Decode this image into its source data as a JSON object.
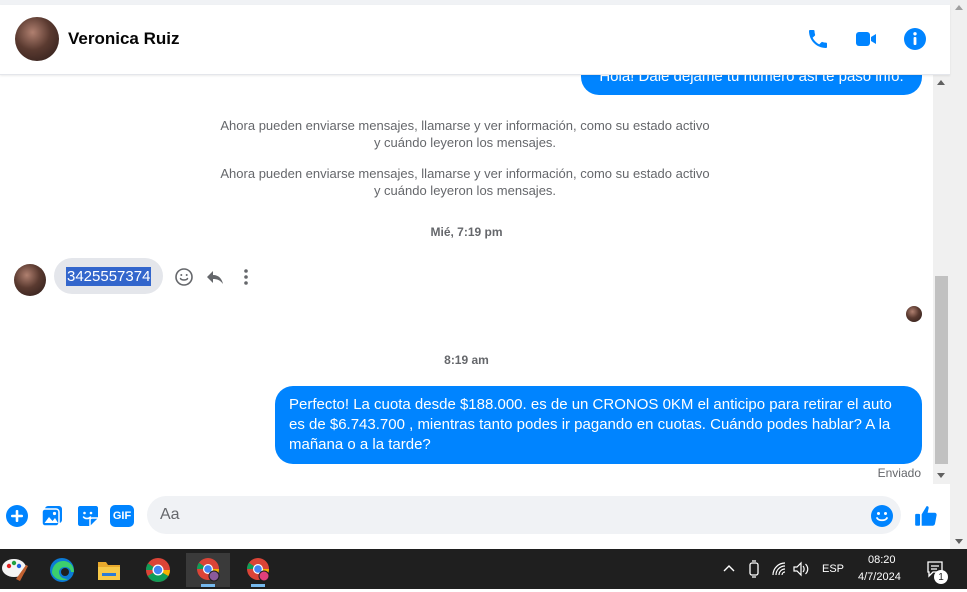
{
  "header": {
    "contact_name": "Veronica Ruiz",
    "icons": [
      "phone-icon",
      "video-camera-icon",
      "info-icon"
    ]
  },
  "colors": {
    "accent": "#0084ff",
    "incoming_bubble": "#e4e6eb",
    "muted_text": "#65676b"
  },
  "messages": {
    "top_outgoing": "Hola! Dale dejame tu numero  asi te paso info.",
    "system_notice_1": "Ahora pueden enviarse mensajes, llamarse y ver información, como su estado activo y cuándo leyeron los mensajes.",
    "system_notice_2": "Ahora pueden enviarse mensajes, llamarse y ver información, como su estado activo y cuándo leyeron los mensajes.",
    "timestamp_1": "Mié, 7:19 pm",
    "incoming_number": "3425557374",
    "timestamp_2": "8:19 am",
    "outgoing_final": "Perfecto! La cuota desde $188.000. es de un CRONOS 0KM el anticipo para retirar el auto es de $6.743.700 , mientras tanto podes ir pagando en cuotas. Cuándo podes hablar? A la mañana o a la tarde?",
    "status": "Enviado"
  },
  "composer": {
    "placeholder": "Aa",
    "icons": [
      "plus-icon",
      "photo-icon",
      "sticker-icon",
      "gif-icon",
      "emoji-icon",
      "thumbs-up-icon"
    ],
    "gif_label": "GIF"
  },
  "taskbar": {
    "apps": [
      "paint-icon",
      "edge-icon",
      "file-explorer-icon",
      "chrome-icon",
      "chrome-profile-icon",
      "chrome-profile-c-icon"
    ],
    "language": "ESP",
    "time": "08:20",
    "date": "4/7/2024",
    "notification_count": "1"
  }
}
